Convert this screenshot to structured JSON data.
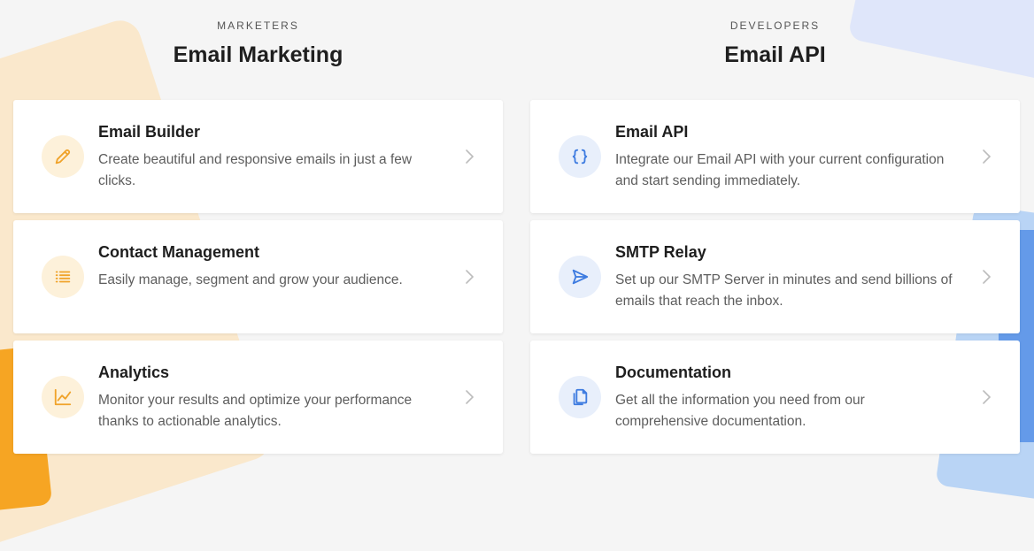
{
  "colors": {
    "accent_orange": "#f0a32a",
    "accent_blue": "#3d7be0",
    "card_bg": "#ffffff",
    "page_bg": "#f5f5f5"
  },
  "marketers": {
    "eyebrow": "MARKETERS",
    "heading": "Email Marketing",
    "cards": [
      {
        "title": "Email Builder",
        "description": "Create beautiful and responsive emails in just a few clicks.",
        "icon": "pencil-icon"
      },
      {
        "title": "Contact Management",
        "description": "Easily manage, segment and grow your audience.",
        "icon": "list-icon"
      },
      {
        "title": "Analytics",
        "description": "Monitor your results and optimize your performance thanks to actionable analytics.",
        "icon": "line-chart-icon"
      }
    ]
  },
  "developers": {
    "eyebrow": "DEVELOPERS",
    "heading": "Email API",
    "cards": [
      {
        "title": "Email API",
        "description": "Integrate our Email API with your current configuration and start sending immediately.",
        "icon": "braces-icon"
      },
      {
        "title": "SMTP Relay",
        "description": "Set up our SMTP Server in minutes and send billions of emails that reach the inbox.",
        "icon": "send-icon"
      },
      {
        "title": "Documentation",
        "description": "Get all the information you need from our comprehensive documentation.",
        "icon": "document-icon"
      }
    ]
  }
}
